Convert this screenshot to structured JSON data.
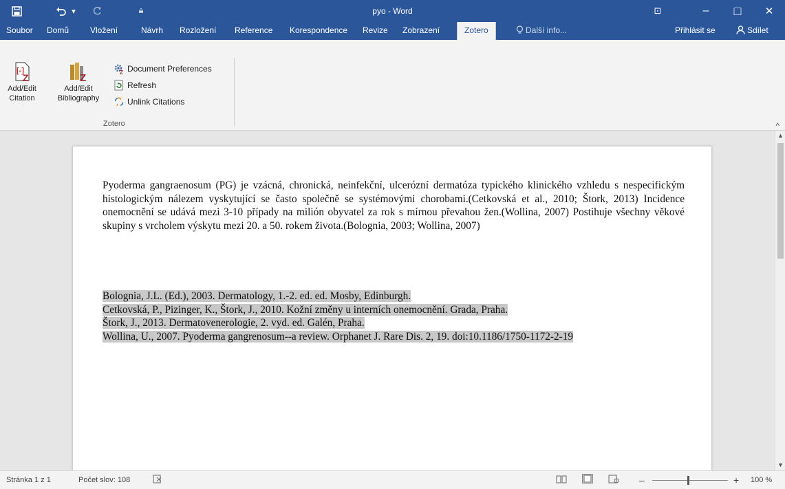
{
  "window": {
    "title": "pyo - Word",
    "minimize_glyph": "–",
    "maximize_glyph": "□",
    "close_glyph": "✕",
    "ribbon_display_glyph": "⊡"
  },
  "quick_access": {
    "save_icon": "floppy-disk-icon",
    "undo_icon": "undo-arrow-icon",
    "undo_dropdown": "▾",
    "redo_icon": "redo-arrow-icon",
    "customize_glyph": "⩧"
  },
  "tabs": [
    "Soubor",
    "Domů",
    "Vložení",
    "Návrh",
    "Rozložení",
    "Reference",
    "Korespondence",
    "Revize",
    "Zobrazení",
    "Zotero"
  ],
  "active_tab": "Zotero",
  "tell_me": "Další info...",
  "sign_in": "Přihlásit se",
  "share": "Sdílet",
  "ribbon": {
    "group_label": "Zotero",
    "add_edit_citation": {
      "line1": "Add/Edit",
      "line2": "Citation"
    },
    "add_edit_bibliography": {
      "line1": "Add/Edit",
      "line2": "Bibliography"
    },
    "document_preferences": "Document Preferences",
    "refresh": "Refresh",
    "unlink_citations": "Unlink Citations",
    "collapse_glyph": "^"
  },
  "document": {
    "body": "Pyoderma gangraenosum (PG) je vzácná, chronická, neinfekční, ulcerózní dermatóza typického klinického vzhledu s nespecifickým histologickým nálezem vyskytující se často společně se systémovými chorobami.(Cetkovská et al., 2010; Štork, 2013) Incidence onemocnění se udává mezi 3-10 případy na milión obyvatel za rok s mírnou převahou žen.(Wollina, 2007) Postihuje všechny věkové skupiny s vrcholem výskytu mezi 20. a 50. rokem života.(Bolognia, 2003; Wollina, 2007)",
    "bibliography": [
      "Bolognia, J.L. (Ed.), 2003. Dermatology, 1.-2. ed. ed. Mosby, Edinburgh.",
      "Cetkovská, P., Pizinger, K., Štork, J., 2010. Kožní změny u interních onemocnění. Grada, Praha.",
      "Štork, J., 2013. Dermatovenerologie, 2. vyd. ed. Galén, Praha.",
      "Wollina, U., 2007. Pyoderma gangrenosum--a review. Orphanet J. Rare Dis. 2, 19. doi:10.1186/1750-1172-2-19"
    ]
  },
  "status": {
    "page": "Stránka 1 z 1",
    "words": "Počet slov: 108",
    "zoom": "100 %",
    "zoom_minus": "–",
    "zoom_plus": "+"
  },
  "colors": {
    "accent": "#2b579a",
    "ribbon_bg": "#f3f3f3",
    "selection": "#c8c8c8"
  }
}
